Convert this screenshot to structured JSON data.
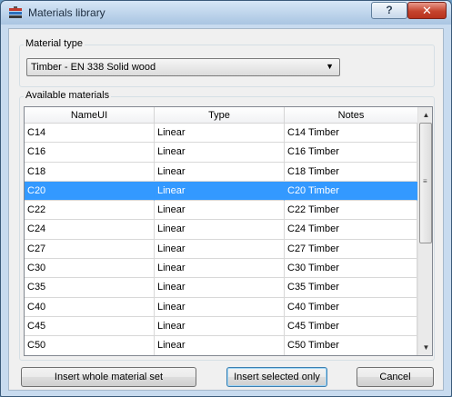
{
  "window": {
    "title": "Materials library",
    "help_label": "?",
    "close_label": "✕"
  },
  "material_type": {
    "group_label": "Material type",
    "selected": "Timber - EN 338 Solid wood"
  },
  "available": {
    "group_label": "Available materials",
    "columns": [
      "NameUI",
      "Type",
      "Notes"
    ],
    "rows": [
      [
        "C14",
        "Linear",
        "C14 Timber"
      ],
      [
        "C16",
        "Linear",
        "C16 Timber"
      ],
      [
        "C18",
        "Linear",
        "C18 Timber"
      ],
      [
        "C20",
        "Linear",
        "C20 Timber"
      ],
      [
        "C22",
        "Linear",
        "C22 Timber"
      ],
      [
        "C24",
        "Linear",
        "C24 Timber"
      ],
      [
        "C27",
        "Linear",
        "C27 Timber"
      ],
      [
        "C30",
        "Linear",
        "C30 Timber"
      ],
      [
        "C35",
        "Linear",
        "C35 Timber"
      ],
      [
        "C40",
        "Linear",
        "C40 Timber"
      ],
      [
        "C45",
        "Linear",
        "C45 Timber"
      ],
      [
        "C50",
        "Linear",
        "C50 Timber"
      ]
    ],
    "selected_row": 3
  },
  "buttons": {
    "insert_whole": "Insert whole material set",
    "insert_selected": "Insert selected only",
    "cancel": "Cancel"
  },
  "colors": {
    "selection": "#3399ff",
    "close_button": "#c5442e"
  }
}
